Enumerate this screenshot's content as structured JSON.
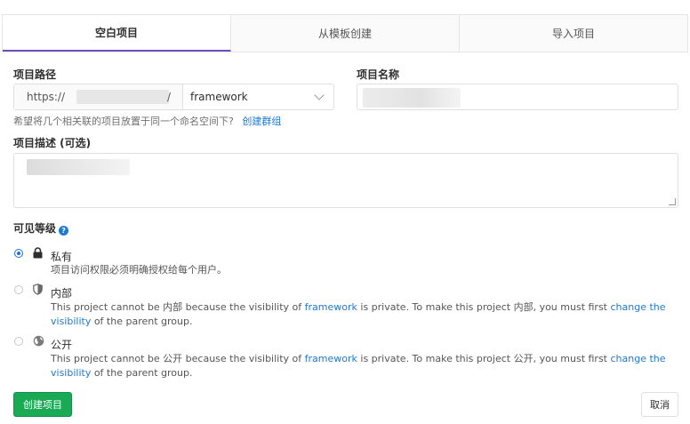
{
  "tabs": [
    {
      "label": "空白项目",
      "active": true
    },
    {
      "label": "从模板创建",
      "active": false
    },
    {
      "label": "导入项目",
      "active": false
    }
  ],
  "project_path": {
    "label": "项目路径",
    "prefix": "https://",
    "slash": "/",
    "namespace": "framework"
  },
  "project_name": {
    "label": "项目名称",
    "value": ""
  },
  "group_help": {
    "text": "希望将几个相关联的项目放置于同一个命名空间下?",
    "link": "创建群组"
  },
  "description": {
    "label": "项目描述 (可选)",
    "value": ""
  },
  "visibility": {
    "label": "可见等级",
    "help_icon": "question-circle-icon",
    "options": [
      {
        "title": "私有",
        "icon": "lock-icon",
        "selected": true,
        "desc": "项目访问权限必须明确授权给每个用户。"
      },
      {
        "title": "内部",
        "icon": "shield-icon",
        "selected": false,
        "desc_pre": "This project cannot be 内部 because the visibility of ",
        "desc_link1": "framework",
        "desc_mid": " is private. To make this project 内部, you must first ",
        "desc_link2": "change the visibility",
        "desc_post": " of the parent group."
      },
      {
        "title": "公开",
        "icon": "globe-icon",
        "selected": false,
        "desc_pre": "This project cannot be 公开 because the visibility of ",
        "desc_link1": "framework",
        "desc_mid": " is private. To make this project 公开, you must first ",
        "desc_link2": "change the visibility",
        "desc_post": " of the parent group."
      }
    ]
  },
  "actions": {
    "create": "创建项目",
    "cancel": "取消"
  },
  "colors": {
    "accent": "#6b4fbb",
    "link": "#1f78d1",
    "create_button": "#1aaa55"
  }
}
